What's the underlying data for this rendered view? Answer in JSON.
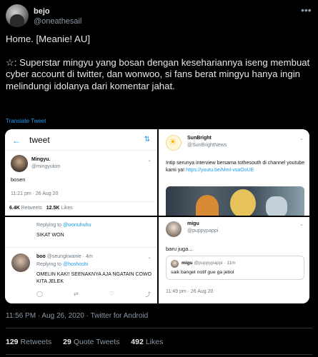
{
  "author": {
    "name": "bejo",
    "handle": "@oneathesail"
  },
  "tweet": {
    "line1": "Home. [Meanie! AU]",
    "line2": "☆: Superstar mingyu yang bosan dengan kesehariannya iseng membuat cyber account di twitter, dan wonwoo, si fans berat mingyu hanya ingin melindungi idolanya dari komentar jahat.",
    "translate": "Translate Tweet"
  },
  "panels": {
    "p1": {
      "back": "←",
      "title": "tweet",
      "name": "Mingyu.",
      "handle": "@mingyukim",
      "body": "bosen",
      "time": "11:21 pm · 26 Aug 20",
      "retweets_num": "6.4K",
      "retweets_label": "Retweets",
      "likes_num": "12.5K",
      "likes_label": "Likes"
    },
    "p2": {
      "name": "SunBright",
      "handle": "@SunBrightNews",
      "body_text": "Intip serunya interview bersama tothesouth di channel youtube kami ya! ",
      "link": "https://youtu.be/Mml-vsaOoUE"
    },
    "p3": {
      "reply_prefix": "Replying to ",
      "reply_to1": "@wonuhuhu",
      "line1": "SIKAT WON",
      "name": "boo",
      "handle_time": "@seungkwanie · 4m",
      "reply_to2": "@hoshoshi",
      "body": "OMELIN KAK!! SEENAKNYA AJA NGATAIN COWO KITA JELEK"
    },
    "p4": {
      "name": "migu",
      "handle": "@puppypappi",
      "body": "baru juga...",
      "quote_name": "migu",
      "quote_meta": "@puppypappi · 11m",
      "quote_body": "saik banget notif gue ga jebol",
      "time": "11:49 pm · 26 Aug 20"
    }
  },
  "meta": "11:56 PM · Aug 26, 2020 · Twitter for Android",
  "stats": {
    "retweets_num": "129",
    "retweets_label": "Retweets",
    "quotes_num": "29",
    "quotes_label": "Quote Tweets",
    "likes_num": "492",
    "likes_label": "Likes"
  },
  "icons": {
    "more": "more-horizontal-icon",
    "back": "arrow-left-icon",
    "sparkle": "sparkle-icon",
    "chevron": "chevron-down-icon"
  },
  "colors": {
    "background": "#000000",
    "link": "#1d9bf0",
    "muted": "#8b98a5"
  }
}
